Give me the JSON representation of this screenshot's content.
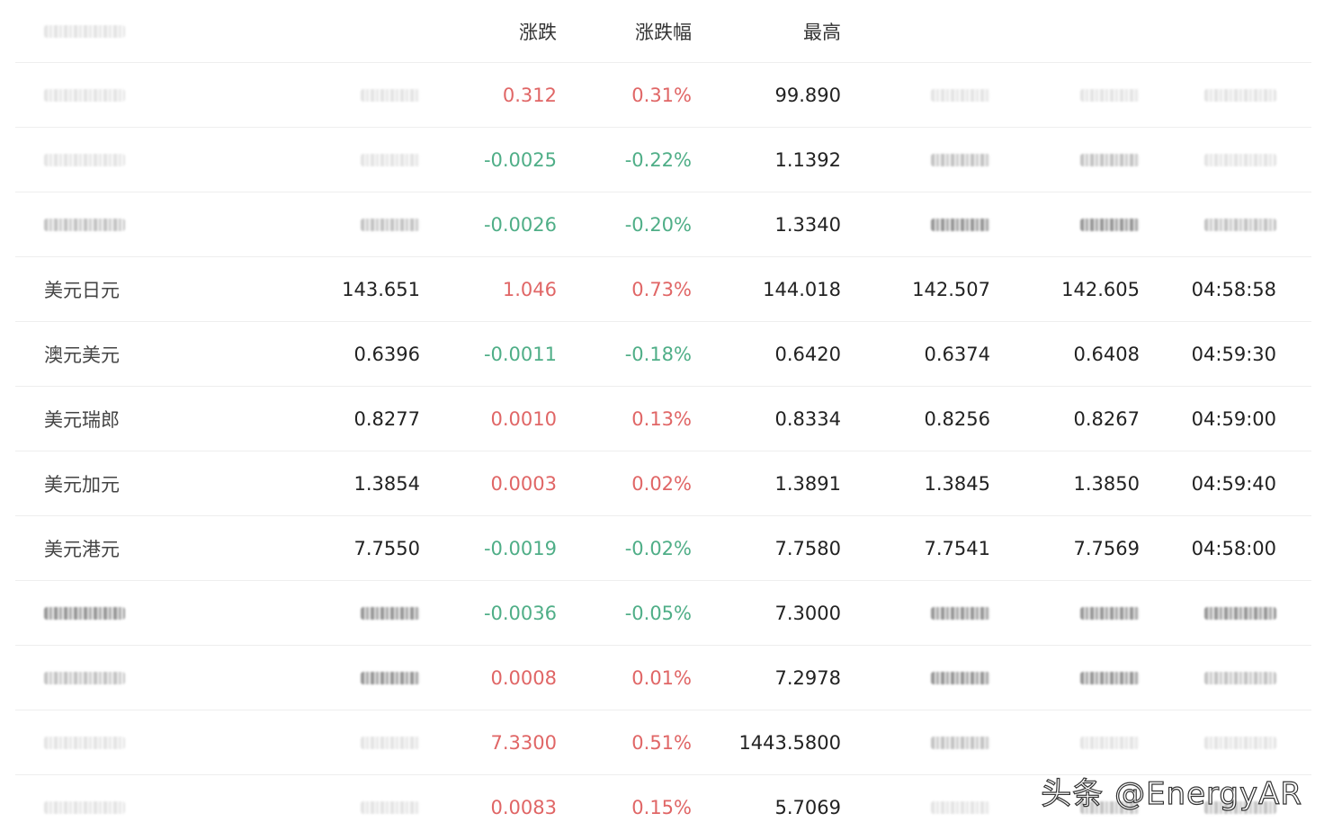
{
  "header": {
    "change": "涨跌",
    "change_pct": "涨跌幅",
    "high": "最高"
  },
  "rows": [
    {
      "name": "",
      "last": "",
      "change": "0.312",
      "change_pct": "0.31%",
      "high": "99.890",
      "low": "",
      "open": "",
      "time": "",
      "direction": "up"
    },
    {
      "name": "",
      "last": "",
      "change": "-0.0025",
      "change_pct": "-0.22%",
      "high": "1.1392",
      "low": "",
      "open": "",
      "time": "",
      "direction": "down"
    },
    {
      "name": "",
      "last": "",
      "change": "-0.0026",
      "change_pct": "-0.20%",
      "high": "1.3340",
      "low": "",
      "open": "",
      "time": "",
      "direction": "down"
    },
    {
      "name": "美元日元",
      "last": "143.651",
      "change": "1.046",
      "change_pct": "0.73%",
      "high": "144.018",
      "low": "142.507",
      "open": "142.605",
      "time": "04:58:58",
      "direction": "up"
    },
    {
      "name": "澳元美元",
      "last": "0.6396",
      "change": "-0.0011",
      "change_pct": "-0.18%",
      "high": "0.6420",
      "low": "0.6374",
      "open": "0.6408",
      "time": "04:59:30",
      "direction": "down"
    },
    {
      "name": "美元瑞郎",
      "last": "0.8277",
      "change": "0.0010",
      "change_pct": "0.13%",
      "high": "0.8334",
      "low": "0.8256",
      "open": "0.8267",
      "time": "04:59:00",
      "direction": "up"
    },
    {
      "name": "美元加元",
      "last": "1.3854",
      "change": "0.0003",
      "change_pct": "0.02%",
      "high": "1.3891",
      "low": "1.3845",
      "open": "1.3850",
      "time": "04:59:40",
      "direction": "up"
    },
    {
      "name": "美元港元",
      "last": "7.7550",
      "change": "-0.0019",
      "change_pct": "-0.02%",
      "high": "7.7580",
      "low": "7.7541",
      "open": "7.7569",
      "time": "04:58:00",
      "direction": "down"
    },
    {
      "name": "",
      "last": "",
      "change": "-0.0036",
      "change_pct": "-0.05%",
      "high": "7.3000",
      "low": "",
      "open": "",
      "time": "",
      "direction": "down"
    },
    {
      "name": "",
      "last": "",
      "change": "0.0008",
      "change_pct": "0.01%",
      "high": "7.2978",
      "low": "",
      "open": "",
      "time": "",
      "direction": "up"
    },
    {
      "name": "",
      "last": "",
      "change": "7.3300",
      "change_pct": "0.51%",
      "high": "1443.5800",
      "low": "",
      "open": "",
      "time": "",
      "direction": "up"
    },
    {
      "name": "",
      "last": "",
      "change": "0.0083",
      "change_pct": "0.15%",
      "high": "5.7069",
      "low": "",
      "open": "",
      "time": "",
      "direction": "up"
    }
  ],
  "colors": {
    "up": "#e06666",
    "down": "#4fae87"
  },
  "watermark": "头条 @EnergyAR"
}
